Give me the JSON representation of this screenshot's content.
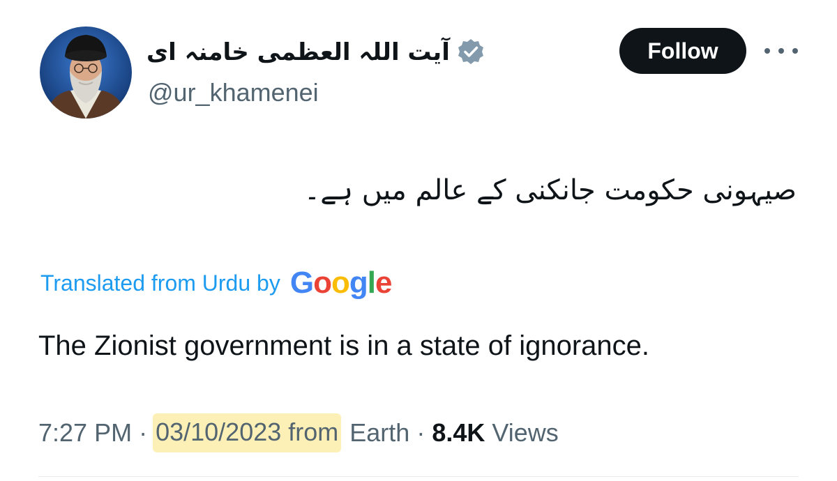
{
  "user": {
    "display_name": "آیت اللہ العظمی خامنہ ای",
    "handle": "@ur_khamenei",
    "verified_icon": "verified-badge-icon"
  },
  "actions": {
    "follow_label": "Follow",
    "more_icon": "more-horizontal-icon"
  },
  "tweet": {
    "original_text": "صیہونی حکومت جانکنی کے عالم میں ہے۔",
    "translation_label": "Translated from Urdu by",
    "translation_provider": "Google",
    "translated_text": "The Zionist government is in a state of ignorance."
  },
  "meta": {
    "time": "7:27 PM",
    "separator": "·",
    "date_from": "03/10/2023 from",
    "location": "Earth",
    "views_count": "8.4K",
    "views_label": "Views"
  },
  "colors": {
    "text_primary": "#0f1419",
    "text_secondary": "#536471",
    "link_blue": "#1d9bf0",
    "follow_bg": "#0f1419",
    "highlight": "#fdf0b6",
    "google_blue": "#4285F4",
    "google_red": "#EA4335",
    "google_yellow": "#FBBC05",
    "google_green": "#34A853"
  }
}
